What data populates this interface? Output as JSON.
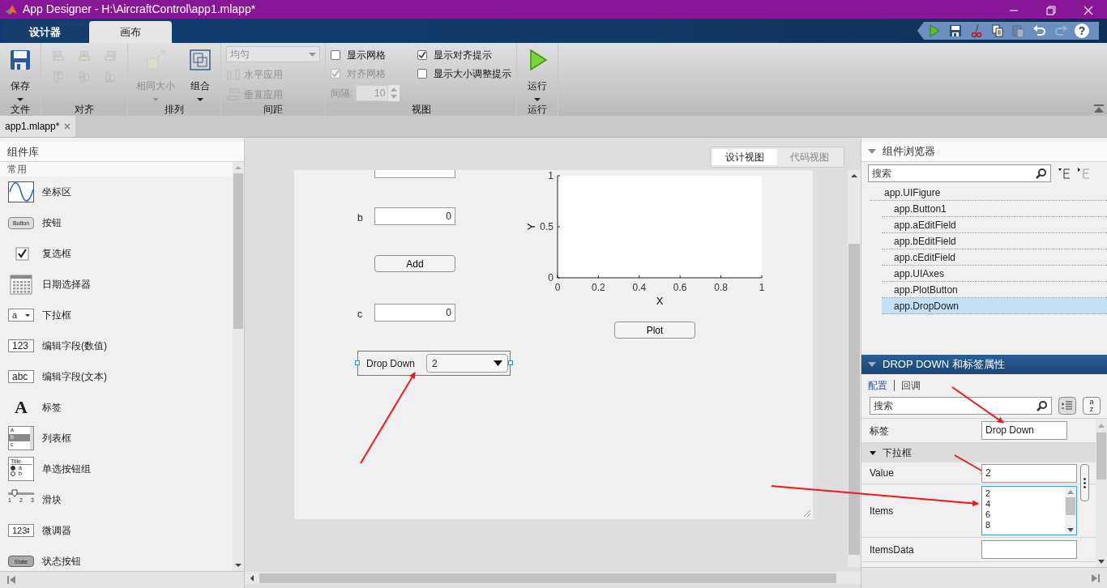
{
  "window": {
    "title": "App Designer - H:\\AircraftControl\\app1.mlapp*"
  },
  "toolstrip_tabs": [
    {
      "label": "设计器",
      "selected": false
    },
    {
      "label": "画布",
      "selected": true
    }
  ],
  "quick_access": [
    {
      "kind": "run",
      "disabled": false
    },
    {
      "kind": "save",
      "disabled": false
    },
    {
      "kind": "cut",
      "disabled": false
    },
    {
      "kind": "copy",
      "disabled": false
    },
    {
      "kind": "paste",
      "disabled": true
    },
    {
      "kind": "undo",
      "disabled": false
    },
    {
      "kind": "redo",
      "disabled": true
    },
    {
      "kind": "help",
      "disabled": false,
      "glyph": "?"
    }
  ],
  "ribbon": {
    "groups": [
      {
        "kind": "file",
        "label": "文件",
        "controls": [
          {
            "kind": "big_button",
            "label": "保存",
            "disabled": false
          }
        ]
      },
      {
        "kind": "align",
        "label": "对齐",
        "controls": [
          {
            "kind": "icon_button",
            "disabled": true
          },
          {
            "kind": "icon_button",
            "disabled": true
          },
          {
            "kind": "icon_button",
            "disabled": true
          },
          {
            "kind": "icon_button",
            "disabled": true
          },
          {
            "kind": "icon_button",
            "disabled": true
          },
          {
            "kind": "icon_button",
            "disabled": true
          }
        ]
      },
      {
        "kind": "arrange",
        "label": "排列",
        "controls": [
          {
            "kind": "big_button",
            "label": "相同大小",
            "disabled": true
          },
          {
            "kind": "big_button",
            "label": "组合",
            "disabled": false
          }
        ]
      },
      {
        "kind": "spacing",
        "label": "间距",
        "controls": [
          {
            "kind": "select",
            "value": "均匀",
            "disabled": true
          },
          {
            "kind": "small_button",
            "label": "水平应用",
            "disabled": true
          },
          {
            "kind": "small_button",
            "label": "垂直应用",
            "disabled": true
          }
        ]
      },
      {
        "kind": "view",
        "label": "视图",
        "controls": [
          {
            "kind": "checkbox",
            "label": "显示网格",
            "checked": false,
            "disabled": false
          },
          {
            "kind": "checkbox",
            "label": "对齐网格",
            "checked": true,
            "disabled": true
          },
          {
            "kind": "spinner",
            "label": "间隔:",
            "value": "10",
            "disabled": true
          },
          {
            "kind": "checkbox",
            "label": "显示对齐提示",
            "checked": true,
            "disabled": false
          },
          {
            "kind": "checkbox",
            "label": "显示大小调整提示",
            "checked": false,
            "disabled": false
          }
        ]
      },
      {
        "kind": "run",
        "label": "运行",
        "controls": [
          {
            "kind": "big_button",
            "label": "运行",
            "disabled": false
          }
        ]
      }
    ]
  },
  "document_tabs": [
    {
      "label": "app1.mlapp*",
      "selected": true
    }
  ],
  "component_library": {
    "title": "组件库",
    "section": "常用",
    "items": [
      {
        "kind": "axes",
        "label": "坐标区"
      },
      {
        "kind": "button",
        "label": "按钮",
        "icon_texts": [
          "Button"
        ]
      },
      {
        "kind": "checkbox",
        "label": "复选框"
      },
      {
        "kind": "datepicker",
        "label": "日期选择器"
      },
      {
        "kind": "dropdown",
        "label": "下拉框",
        "icon_texts": [
          "a"
        ]
      },
      {
        "kind": "numeric",
        "label": "编辑字段(数值)",
        "icon_texts": [
          "123"
        ]
      },
      {
        "kind": "text",
        "label": "编辑字段(文本)",
        "icon_texts": [
          "abc"
        ]
      },
      {
        "kind": "label",
        "label": "标签",
        "icon_texts": [
          "A"
        ]
      },
      {
        "kind": "listbox",
        "label": "列表框",
        "icon_texts": [
          "a",
          "b",
          "c"
        ]
      },
      {
        "kind": "radiogroup",
        "label": "单选按钮组",
        "icon_texts": [
          "Title",
          "a",
          "b"
        ]
      },
      {
        "kind": "slider",
        "label": "滑块",
        "icon_texts": [
          "1",
          "2",
          "3"
        ]
      },
      {
        "kind": "spinner",
        "label": "微调器",
        "icon_texts": [
          "123"
        ]
      },
      {
        "kind": "state",
        "label": "状态按钮",
        "icon_texts": [
          "State"
        ]
      }
    ]
  },
  "view_toggle": [
    {
      "label": "设计视图",
      "selected": true
    },
    {
      "label": "代码视图",
      "selected": false
    }
  ],
  "canvas": {
    "components": [
      {
        "kind": "edit_field"
      },
      {
        "kind": "edit_field",
        "label": "b",
        "value": "0"
      },
      {
        "kind": "button",
        "text": "Add"
      },
      {
        "kind": "edit_field",
        "label": "c",
        "value": "0"
      },
      {
        "kind": "dropdown",
        "label": "Drop Down",
        "value": "2",
        "selected": true
      },
      {
        "kind": "axes",
        "chart_data": {
          "type": "line",
          "xlabel": "X",
          "ylabel": "Y",
          "xlim": [
            0,
            1
          ],
          "ylim": [
            0,
            1
          ],
          "xticks": [
            0,
            0.2,
            0.4,
            0.6,
            0.8,
            1
          ],
          "yticks": [
            0,
            0.5,
            1
          ]
        }
      },
      {
        "kind": "button",
        "text": "Plot"
      }
    ]
  },
  "component_browser": {
    "title": "组件浏览器",
    "search_placeholder": "搜索",
    "tree": [
      {
        "label": "app.UIFigure",
        "selected": false,
        "children": [
          {
            "label": "app.Button1",
            "selected": false
          },
          {
            "label": "app.aEditField",
            "selected": false
          },
          {
            "label": "app.bEditField",
            "selected": false
          },
          {
            "label": "app.cEditField",
            "selected": false
          },
          {
            "label": "app.UIAxes",
            "selected": false
          },
          {
            "label": "app.PlotButton",
            "selected": false
          },
          {
            "label": "app.DropDown",
            "selected": true
          }
        ]
      }
    ]
  },
  "inspector": {
    "title": "DROP DOWN 和标签属性",
    "tabs": [
      {
        "label": "配置",
        "selected": true
      },
      {
        "label": "回调",
        "selected": false
      }
    ],
    "search_placeholder": "搜索",
    "sort_glyphs": [
      "a",
      "z"
    ],
    "properties": [
      {
        "kind": "text",
        "label": "标签",
        "value": "Drop Down"
      },
      {
        "kind": "section",
        "label": "下拉框",
        "expanded": true
      },
      {
        "kind": "text",
        "label": "Value",
        "value": "2",
        "has_editor": true
      },
      {
        "kind": "list",
        "label": "Items",
        "items": [
          "2",
          "4",
          "6",
          "8"
        ]
      },
      {
        "kind": "text",
        "label": "ItemsData"
      }
    ]
  }
}
